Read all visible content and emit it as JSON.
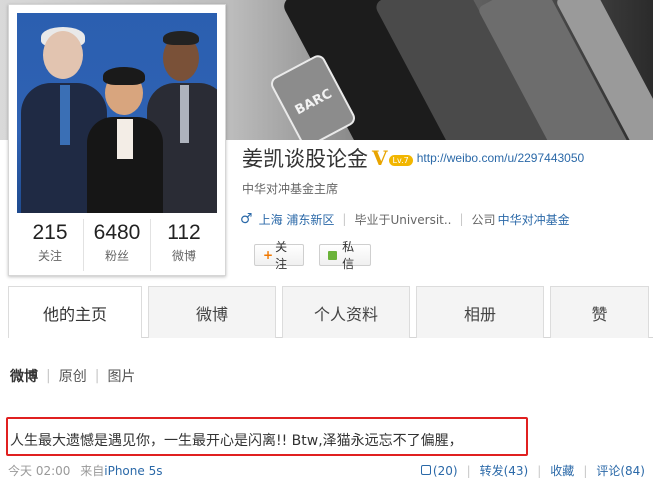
{
  "cover": {
    "sign_text": "BARC"
  },
  "profile": {
    "name": "姜凯谈股论金",
    "verified_mark": "V",
    "level_badge": "Lv.7",
    "url": "http://weibo.com/u/2297443050",
    "title": "中华对冲基金主席",
    "gender_icon": "♂",
    "location": "上海 浦东新区",
    "education": "毕业于Universit..",
    "company_label": "公司",
    "company": "中华对冲基金"
  },
  "stats": [
    {
      "value": "215",
      "label": "关注"
    },
    {
      "value": "6480",
      "label": "粉丝"
    },
    {
      "value": "112",
      "label": "微博"
    }
  ],
  "buttons": {
    "follow": "+关注",
    "follow_plus": "+",
    "follow_text": "关注",
    "message": "私信"
  },
  "tabs": [
    "他的主页",
    "微博",
    "个人资料",
    "相册",
    "赞"
  ],
  "subtabs": [
    "微博",
    "原创",
    "图片"
  ],
  "post": {
    "text": "人生最大遗憾是遇见你，一生最开心是闪离!! Btw,泽猫永远忘不了偏腥，",
    "time": "今天 02:00",
    "source_prefix": "来自",
    "source": "iPhone 5s",
    "like": "(20)",
    "repost": "转发(43)",
    "favorite": "收藏",
    "comment": "评论(84)"
  },
  "colors": {
    "link": "#2b69a8",
    "highlight_box": "#e02020",
    "verified": "#e8a400"
  }
}
